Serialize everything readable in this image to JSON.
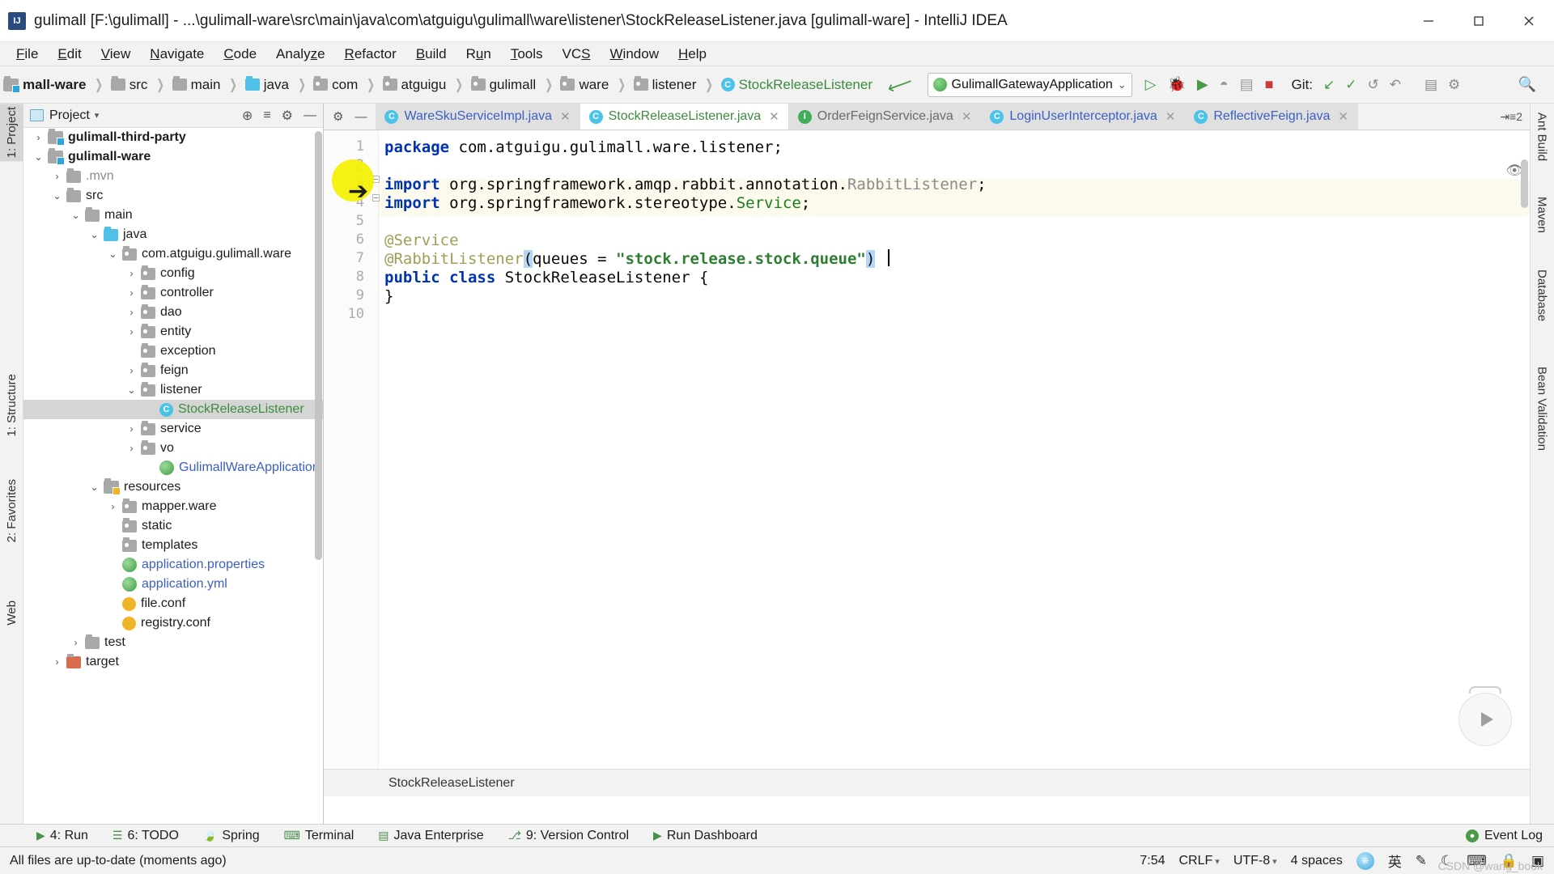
{
  "window": {
    "title": "gulimall [F:\\gulimall] - ...\\gulimall-ware\\src\\main\\java\\com\\atguigu\\gulimall\\ware\\listener\\StockReleaseListener.java [gulimall-ware] - IntelliJ IDEA",
    "app_icon": "intellij-idea-logo",
    "minimize": "—",
    "maximize": "☐",
    "close": "✕"
  },
  "menubar": {
    "items": [
      {
        "label": "File",
        "mnemonic": "F"
      },
      {
        "label": "Edit",
        "mnemonic": "E"
      },
      {
        "label": "View",
        "mnemonic": "V"
      },
      {
        "label": "Navigate",
        "mnemonic": "N"
      },
      {
        "label": "Code",
        "mnemonic": "C"
      },
      {
        "label": "Analyze",
        "mnemonic": "z"
      },
      {
        "label": "Refactor",
        "mnemonic": "R"
      },
      {
        "label": "Build",
        "mnemonic": "B"
      },
      {
        "label": "Run",
        "mnemonic": "u"
      },
      {
        "label": "Tools",
        "mnemonic": "T"
      },
      {
        "label": "VCS",
        "mnemonic": "S"
      },
      {
        "label": "Window",
        "mnemonic": "W"
      },
      {
        "label": "Help",
        "mnemonic": "H"
      }
    ]
  },
  "navbar": {
    "breadcrumbs": [
      {
        "label": "mall-ware",
        "icon": "module-icon",
        "style": "bold"
      },
      {
        "label": "src",
        "icon": "folder-icon",
        "style": "normal"
      },
      {
        "label": "main",
        "icon": "folder-icon",
        "style": "normal"
      },
      {
        "label": "java",
        "icon": "source-folder-icon",
        "style": "normal"
      },
      {
        "label": "com",
        "icon": "package-icon",
        "style": "normal"
      },
      {
        "label": "atguigu",
        "icon": "package-icon",
        "style": "normal"
      },
      {
        "label": "gulimall",
        "icon": "package-icon",
        "style": "normal"
      },
      {
        "label": "ware",
        "icon": "package-icon",
        "style": "normal"
      },
      {
        "label": "listener",
        "icon": "package-icon",
        "style": "normal"
      },
      {
        "label": "StockReleaseListener",
        "icon": "class-icon",
        "style": "green"
      }
    ],
    "build_icon": "hammer-icon",
    "run_config": {
      "name": "GulimallGatewayApplication",
      "icon": "spring-boot-icon",
      "chevron": "⌄"
    },
    "actions": [
      {
        "name": "run-icon",
        "glyph": "▷"
      },
      {
        "name": "debug-icon",
        "glyph": "🐞"
      },
      {
        "name": "run-with-coverage-icon",
        "glyph": "▶"
      },
      {
        "name": "profiler-icon",
        "glyph": "◔"
      },
      {
        "name": "attach-icon",
        "glyph": "☰"
      },
      {
        "name": "stop-icon",
        "glyph": "■"
      }
    ],
    "git_label": "Git:",
    "git_actions": [
      {
        "name": "update-project-icon",
        "glyph": "↙"
      },
      {
        "name": "commit-icon",
        "glyph": "✓"
      },
      {
        "name": "history-icon",
        "glyph": "↺"
      },
      {
        "name": "rollback-icon",
        "glyph": "↶"
      }
    ],
    "extra_actions": [
      {
        "name": "select-run-config-icon",
        "glyph": "☰"
      },
      {
        "name": "ide-settings-icon",
        "glyph": "⚙"
      }
    ],
    "search_icon": "search-everywhere-icon"
  },
  "left_rail": [
    {
      "label": "1: Project",
      "icon": "project-icon",
      "selected": true
    },
    {
      "label": "1: Structure",
      "icon": "structure-icon",
      "selected": false
    },
    {
      "label": "2: Favorites",
      "icon": "favorites-icon",
      "selected": false
    },
    {
      "label": "Web",
      "icon": "web-icon",
      "selected": false
    }
  ],
  "right_rail": [
    {
      "label": "Ant Build",
      "icon": "ant-icon"
    },
    {
      "label": "Maven",
      "icon": "maven-icon"
    },
    {
      "label": "Database",
      "icon": "database-icon"
    },
    {
      "label": "Bean Validation",
      "icon": "bean-validation-icon"
    }
  ],
  "project_panel": {
    "title": "Project",
    "title_icon": "project-view-icon",
    "caret": "▾",
    "actions": [
      {
        "name": "scroll-from-source-icon",
        "glyph": "⊕"
      },
      {
        "name": "collapse-all-icon",
        "glyph": "≡"
      },
      {
        "name": "settings-icon",
        "glyph": "⚙"
      },
      {
        "name": "hide-icon",
        "glyph": "—"
      }
    ],
    "tree": [
      {
        "label": "gulimall-third-party",
        "indent": 0,
        "arrow": "›",
        "icon": "module-icon",
        "style": "bold",
        "selected": false
      },
      {
        "label": "gulimall-ware",
        "indent": 0,
        "arrow": "⌄",
        "icon": "module-icon",
        "style": "bold",
        "selected": false
      },
      {
        "label": ".mvn",
        "indent": 1,
        "arrow": "›",
        "icon": "folder-icon",
        "style": "dim",
        "selected": false
      },
      {
        "label": "src",
        "indent": 1,
        "arrow": "⌄",
        "icon": "folder-icon",
        "style": "normal",
        "selected": false
      },
      {
        "label": "main",
        "indent": 2,
        "arrow": "⌄",
        "icon": "folder-icon",
        "style": "normal",
        "selected": false
      },
      {
        "label": "java",
        "indent": 3,
        "arrow": "⌄",
        "icon": "source-folder-icon",
        "style": "normal",
        "selected": false
      },
      {
        "label": "com.atguigu.gulimall.ware",
        "indent": 4,
        "arrow": "⌄",
        "icon": "package-icon",
        "style": "normal",
        "selected": false
      },
      {
        "label": "config",
        "indent": 5,
        "arrow": "›",
        "icon": "package-icon",
        "style": "normal",
        "selected": false
      },
      {
        "label": "controller",
        "indent": 5,
        "arrow": "›",
        "icon": "package-icon",
        "style": "normal",
        "selected": false
      },
      {
        "label": "dao",
        "indent": 5,
        "arrow": "›",
        "icon": "package-icon",
        "style": "normal",
        "selected": false
      },
      {
        "label": "entity",
        "indent": 5,
        "arrow": "›",
        "icon": "package-icon",
        "style": "normal",
        "selected": false
      },
      {
        "label": "exception",
        "indent": 5,
        "arrow": "",
        "icon": "package-icon",
        "style": "normal",
        "selected": false
      },
      {
        "label": "feign",
        "indent": 5,
        "arrow": "›",
        "icon": "package-icon",
        "style": "normal",
        "selected": false
      },
      {
        "label": "listener",
        "indent": 5,
        "arrow": "⌄",
        "icon": "package-icon",
        "style": "normal",
        "selected": false
      },
      {
        "label": "StockReleaseListener",
        "indent": 6,
        "arrow": "",
        "icon": "class-icon",
        "style": "green",
        "selected": true
      },
      {
        "label": "service",
        "indent": 5,
        "arrow": "›",
        "icon": "package-icon",
        "style": "normal",
        "selected": false
      },
      {
        "label": "vo",
        "indent": 5,
        "arrow": "›",
        "icon": "package-icon",
        "style": "normal",
        "selected": false
      },
      {
        "label": "GulimallWareApplication",
        "indent": 6,
        "arrow": "",
        "icon": "spring-class-icon",
        "style": "blue",
        "selected": false
      },
      {
        "label": "resources",
        "indent": 3,
        "arrow": "⌄",
        "icon": "resources-folder-icon",
        "style": "normal",
        "selected": false
      },
      {
        "label": "mapper.ware",
        "indent": 4,
        "arrow": "›",
        "icon": "package-icon",
        "style": "normal",
        "selected": false
      },
      {
        "label": "static",
        "indent": 4,
        "arrow": "",
        "icon": "package-icon",
        "style": "normal",
        "selected": false
      },
      {
        "label": "templates",
        "indent": 4,
        "arrow": "",
        "icon": "package-icon",
        "style": "normal",
        "selected": false
      },
      {
        "label": "application.properties",
        "indent": 4,
        "arrow": "",
        "icon": "spring-config-icon",
        "style": "blue",
        "selected": false
      },
      {
        "label": "application.yml",
        "indent": 4,
        "arrow": "",
        "icon": "spring-config-icon",
        "style": "blue",
        "selected": false
      },
      {
        "label": "file.conf",
        "indent": 4,
        "arrow": "",
        "icon": "conf-file-icon",
        "style": "normal",
        "selected": false
      },
      {
        "label": "registry.conf",
        "indent": 4,
        "arrow": "",
        "icon": "conf-file-icon",
        "style": "normal",
        "selected": false
      },
      {
        "label": "test",
        "indent": 2,
        "arrow": "›",
        "icon": "folder-icon",
        "style": "normal",
        "selected": false
      },
      {
        "label": "target",
        "indent": 1,
        "arrow": "›",
        "icon": "target-folder-icon",
        "style": "normal",
        "selected": false
      }
    ]
  },
  "editor": {
    "tabs": [
      {
        "label": "WareSkuServiceImpl.java",
        "icon": "class-icon",
        "state": "inactive",
        "color": "blue",
        "close": "✕"
      },
      {
        "label": "StockReleaseListener.java",
        "icon": "class-icon",
        "state": "active",
        "color": "green",
        "close": "✕"
      },
      {
        "label": "OrderFeignService.java",
        "icon": "interface-icon",
        "state": "inactive",
        "color": "gray",
        "close": "✕"
      },
      {
        "label": "LoginUserInterceptor.java",
        "icon": "class-icon",
        "state": "inactive",
        "color": "blue",
        "close": "✕"
      },
      {
        "label": "ReflectiveFeign.java",
        "icon": "class-icon",
        "state": "inactive",
        "color": "blue",
        "close": "✕"
      }
    ],
    "tab_overflow": "⇥≡2",
    "line_numbers": [
      "1",
      "2",
      "3",
      "4",
      "5",
      "6",
      "7",
      "8",
      "9",
      "10"
    ],
    "code_lines": [
      {
        "n": 1,
        "segments": [
          {
            "t": "package",
            "c": "kw"
          },
          {
            "t": " com.atguigu.gulimall.ware.listener;",
            "c": "ident"
          }
        ]
      },
      {
        "n": 2,
        "segments": []
      },
      {
        "n": 3,
        "segments": [
          {
            "t": "import",
            "c": "kw"
          },
          {
            "t": " org.springframework.amqp.rabbit.annotation.",
            "c": "ident"
          },
          {
            "t": "RabbitListener",
            "c": "dim"
          },
          {
            "t": ";",
            "c": "ident"
          }
        ]
      },
      {
        "n": 4,
        "segments": [
          {
            "t": "import",
            "c": "kw"
          },
          {
            "t": " org.springframework.stereotype.",
            "c": "ident"
          },
          {
            "t": "Service",
            "c": "typ"
          },
          {
            "t": ";",
            "c": "ident"
          }
        ]
      },
      {
        "n": 5,
        "segments": []
      },
      {
        "n": 6,
        "segments": [
          {
            "t": "@Service",
            "c": "anno"
          }
        ]
      },
      {
        "n": 7,
        "segments": [
          {
            "t": "@RabbitListener",
            "c": "anno"
          },
          {
            "t": "(",
            "c": "paren-hl"
          },
          {
            "t": "queues = ",
            "c": "ident"
          },
          {
            "t": "\"stock.release.stock.queue\"",
            "c": "str"
          },
          {
            "t": ")",
            "c": "paren-hl"
          }
        ]
      },
      {
        "n": 8,
        "segments": [
          {
            "t": "public",
            "c": "kw"
          },
          {
            "t": " ",
            "c": "ident"
          },
          {
            "t": "class",
            "c": "kw"
          },
          {
            "t": " StockReleaseListener {",
            "c": "ident"
          }
        ]
      },
      {
        "n": 9,
        "segments": [
          {
            "t": "}",
            "c": "ident"
          }
        ]
      },
      {
        "n": 10,
        "segments": []
      }
    ],
    "breadcrumb_bottom": "StockReleaseListener",
    "inspection_icon": "no-problems-icon",
    "run_widget_icon": "run-inline-icon"
  },
  "bottom_toolwindows": [
    {
      "label": "4: Run",
      "icon": "run-icon",
      "glyph": "▶"
    },
    {
      "label": "6: TODO",
      "icon": "todo-icon",
      "glyph": "☰"
    },
    {
      "label": "Spring",
      "icon": "spring-icon",
      "glyph": "🍃"
    },
    {
      "label": "Terminal",
      "icon": "terminal-icon",
      "glyph": "⌨"
    },
    {
      "label": "Java Enterprise",
      "icon": "java-enterprise-icon",
      "glyph": "▤"
    },
    {
      "label": "9: Version Control",
      "icon": "version-control-icon",
      "glyph": "⎇"
    },
    {
      "label": "Run Dashboard",
      "icon": "run-dashboard-icon",
      "glyph": "▶"
    }
  ],
  "bottom_right": {
    "event_log_label": "Event Log",
    "event_log_icon": "event-log-icon"
  },
  "statusbar": {
    "message": "All files are up-to-date (moments ago)",
    "caret_position": "7:54",
    "line_separator": "CRLF",
    "encoding": "UTF-8",
    "indent": "4 spaces",
    "ime_label": "英",
    "icons": [
      {
        "name": "ime-globe-icon",
        "glyph": "ⓤ"
      },
      {
        "name": "ime-mode-icon",
        "glyph": "英"
      },
      {
        "name": "ime-pen-icon",
        "glyph": "✎"
      },
      {
        "name": "ime-moon-icon",
        "glyph": "☾"
      },
      {
        "name": "keyboard-icon",
        "glyph": "⌨"
      },
      {
        "name": "lock-icon",
        "glyph": "🔒"
      },
      {
        "name": "notifications-icon",
        "glyph": "▣"
      }
    ],
    "watermark": "CSDN @wang_book"
  }
}
